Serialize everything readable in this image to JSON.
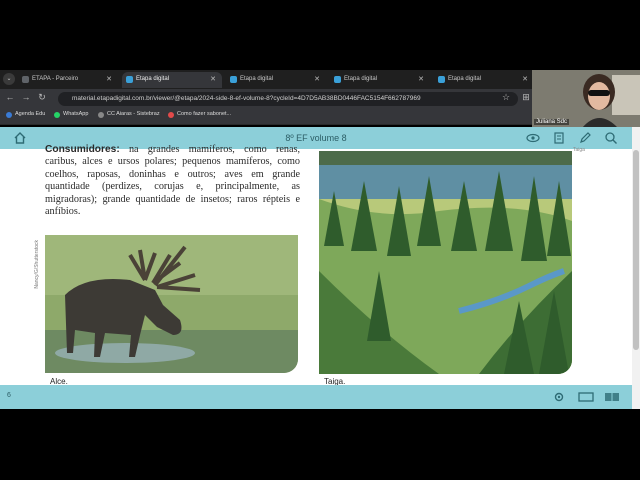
{
  "browser": {
    "tabs": [
      {
        "label": "ETAPA - Parceiro",
        "active": false,
        "color": "#5f6368"
      },
      {
        "label": "Etapa digital",
        "active": true,
        "color": "#3aa0d8"
      },
      {
        "label": "Etapa digital",
        "active": false,
        "color": "#3aa0d8"
      },
      {
        "label": "Etapa digital",
        "active": false,
        "color": "#3aa0d8"
      },
      {
        "label": "Etapa digital",
        "active": false,
        "color": "#3aa0d8"
      }
    ],
    "url": "material.etapadigital.com.br/viewer/@etapa/2024-side-8-ef-volume-8?cycleId=4D7D5AB38BD0446FAC5154F66278796​9",
    "bookmarks": [
      {
        "label": "Agenda Edu",
        "color": "#3a7bd5"
      },
      {
        "label": "WhatsApp",
        "color": "#25d366"
      },
      {
        "label": "CC Aiaras - Sistebraz",
        "color": "#888888"
      },
      {
        "label": "Como fazer sabonet...",
        "color": "#e24a4a"
      }
    ]
  },
  "webcam": {
    "name": "Juliana Sdc"
  },
  "viewer": {
    "title": "8º EF volume 8",
    "page_number": "6",
    "accent_color": "#8ccfd9"
  },
  "page": {
    "text_bold": "Consumidores:",
    "text_rest": " na grandes mamíferos, como renas, caribus, alces e ursos polares; pequenos mamíferos, como coelhos, raposas, doninhas e outros; aves em grande quantidade (perdizes, corujas e, principalmente, as migradoras); grande quantidade de insetos; raros répteis e anfíbios.",
    "photo_credit": "Nancy/G/Shutterstock",
    "moose_caption": "Alce.",
    "taiga_caption": "Taiga.",
    "side_label": "Taiga"
  }
}
